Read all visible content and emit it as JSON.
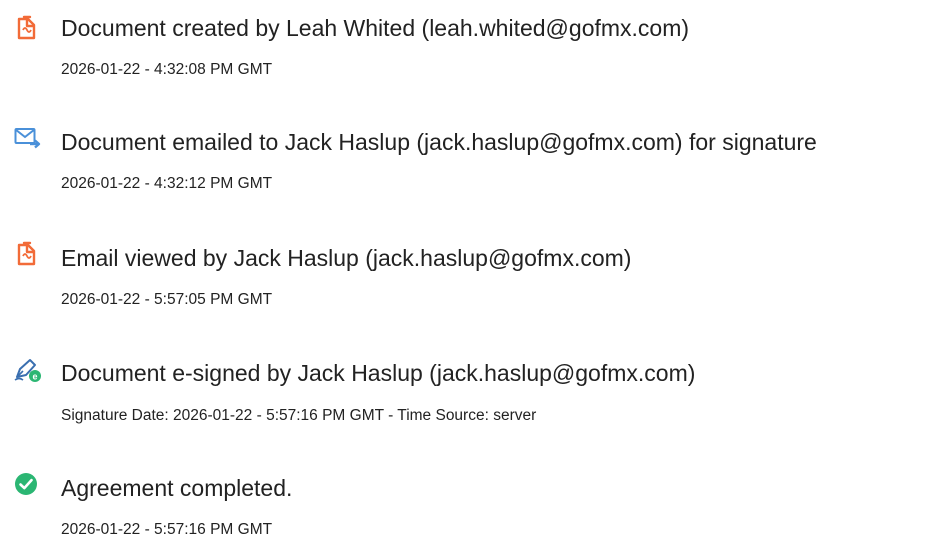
{
  "audit_events": [
    {
      "icon": "document-created-icon",
      "title": "Document created by Leah Whited (leah.whited@gofmx.com)",
      "detail": "2026-01-22 - 4:32:08 PM GMT"
    },
    {
      "icon": "email-sent-icon",
      "title": "Document emailed to Jack Haslup (jack.haslup@gofmx.com) for signature",
      "detail": "2026-01-22 - 4:32:12 PM GMT"
    },
    {
      "icon": "email-viewed-icon",
      "title": "Email viewed by Jack Haslup (jack.haslup@gofmx.com)",
      "detail": "2026-01-22 - 5:57:05 PM GMT"
    },
    {
      "icon": "e-signed-icon",
      "title": "Document e-signed by Jack Haslup (jack.haslup@gofmx.com)",
      "detail": "Signature Date: 2026-01-22 - 5:57:16 PM GMT - Time Source: server"
    },
    {
      "icon": "completed-check-icon",
      "title": "Agreement completed.",
      "detail": "2026-01-22 - 5:57:16 PM GMT"
    }
  ],
  "colors": {
    "document_icon": "#f26b38",
    "email_icon": "#4a90d9",
    "sign_icon": "#3a6fb0",
    "check_icon": "#2bb673",
    "text": "#222222"
  }
}
